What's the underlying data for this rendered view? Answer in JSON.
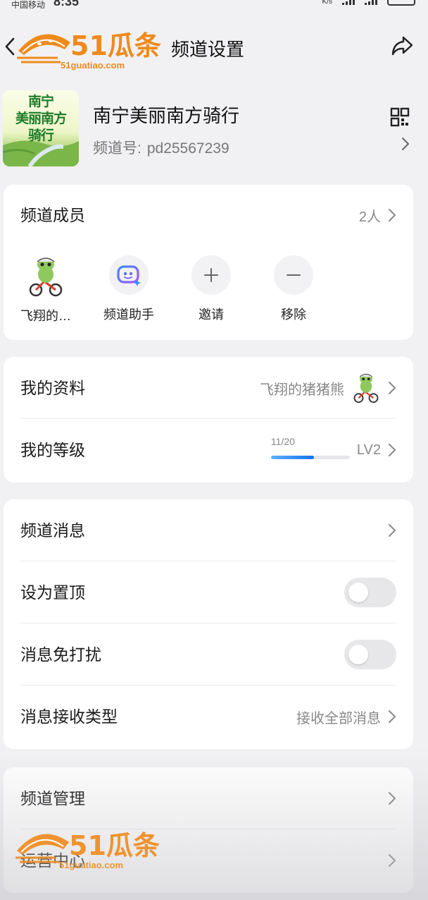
{
  "status_bar": {
    "carrier": "中国移动",
    "time": "8:35",
    "net_speed": "K/s"
  },
  "header": {
    "title": "频道设置",
    "watermark_text": "51瓜条",
    "watermark_url": "51guatiao.com"
  },
  "channel": {
    "name": "南宁美丽南方骑行",
    "id_label": "频道号:",
    "id_value": "pd25567239",
    "avatar_text": [
      "南宁",
      "美丽南方",
      "骑行"
    ]
  },
  "members": {
    "label": "频道成员",
    "count": "2人",
    "items": [
      {
        "label": "飞翔的…",
        "icon": "cyclist-frog-avatar"
      },
      {
        "label": "频道助手",
        "icon": "robot-assistant-icon"
      },
      {
        "label": "邀请",
        "icon": "plus-icon"
      },
      {
        "label": "移除",
        "icon": "minus-icon"
      }
    ]
  },
  "profile": {
    "my_profile_label": "我的资料",
    "nickname": "飞翔的猪猪熊",
    "my_level_label": "我的等级",
    "level_progress": "11/20",
    "level_progress_fraction": 0.55,
    "level": "LV2"
  },
  "messages": {
    "channel_messages_label": "频道消息",
    "pin_top_label": "设为置顶",
    "pin_top_on": false,
    "dnd_label": "消息免打扰",
    "dnd_on": false,
    "receive_type_label": "消息接收类型",
    "receive_type_value": "接收全部消息"
  },
  "management": {
    "channel_management_label": "频道管理",
    "operations_center_label": "运营中心"
  },
  "colors": {
    "accent_blue": "#1672f0",
    "logo_orange": "#f08a1c",
    "avatar_green": "#1e7b28"
  }
}
